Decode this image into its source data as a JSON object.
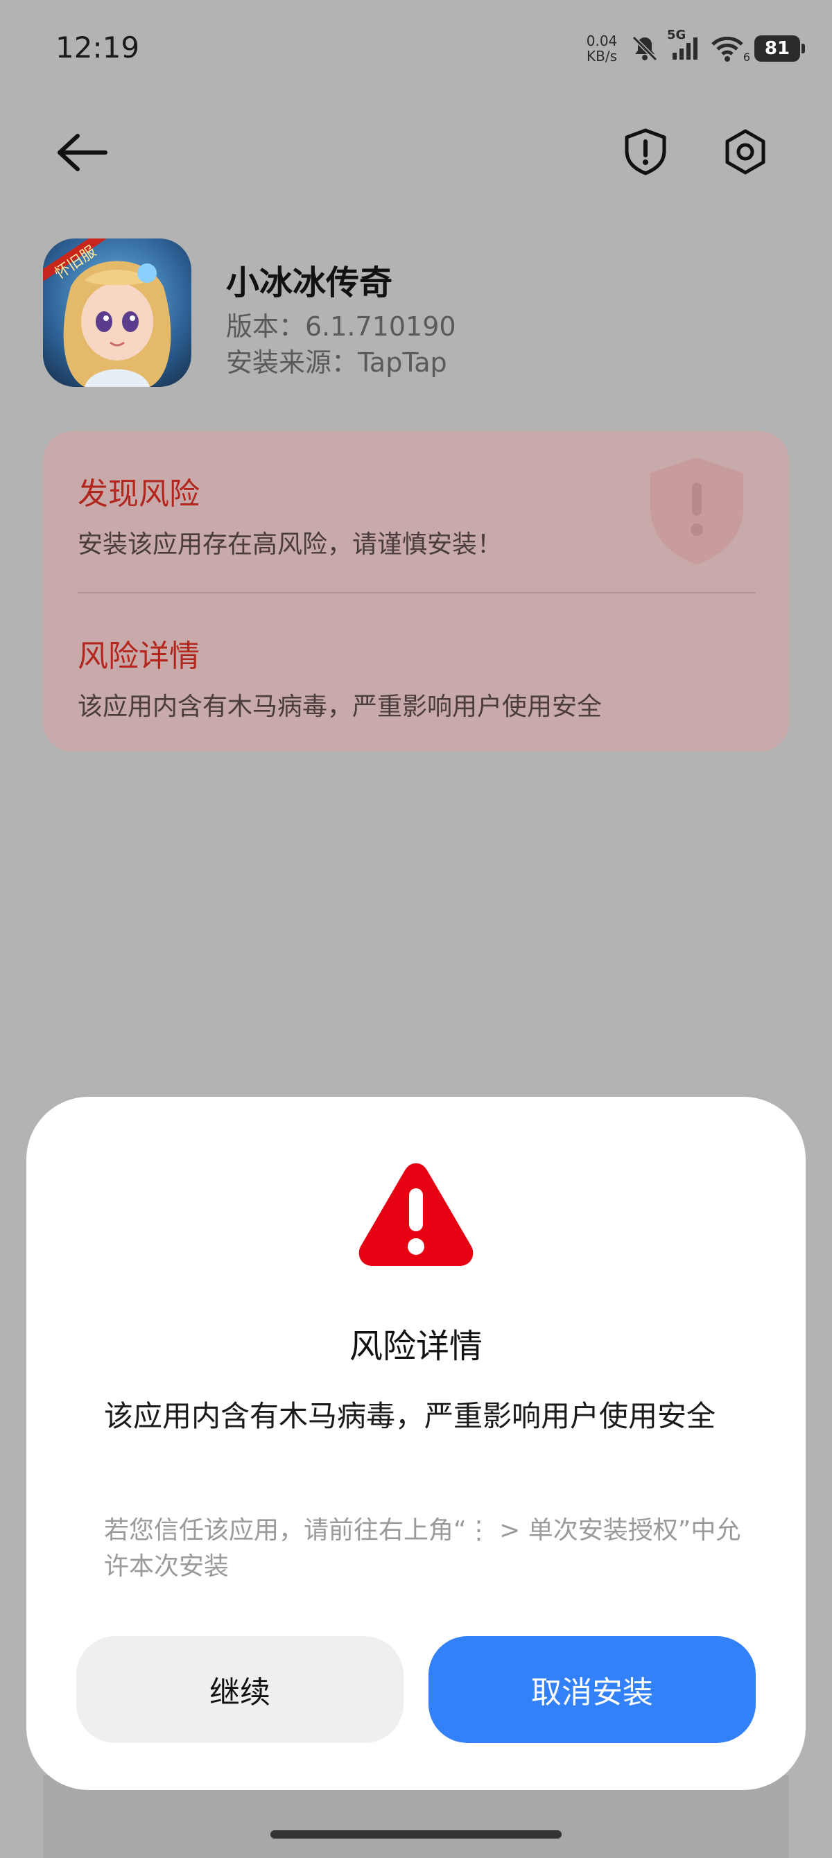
{
  "status_bar": {
    "time": "12:19",
    "net_speed_value": "0.04",
    "net_speed_unit": "KB/s",
    "network_type": "5G",
    "wifi_level": "6",
    "battery_level": "81",
    "icons": [
      "mute-bell-icon",
      "cellular-signal-icon",
      "wifi-icon",
      "battery-icon"
    ]
  },
  "nav": {
    "back_icon": "back-arrow-icon",
    "actions": [
      "shield-alert-icon",
      "settings-gear-icon"
    ]
  },
  "app": {
    "name": "小冰冰传奇",
    "version": "版本：6.1.710190",
    "source": "安装来源：TapTap",
    "icon_badge": "怀旧服"
  },
  "risk_card": {
    "found_title": "发现风险",
    "found_text": "安装该应用存在高风险，请谨慎安装！",
    "details_title": "风险详情",
    "details_text": "该应用内含有木马病毒，严重影响用户使用安全"
  },
  "dialog": {
    "title": "风险详情",
    "body": "该应用内含有木马病毒，严重影响用户使用安全",
    "hint": "若您信任该应用，请前往右上角“⋮ > 单次安装授权”中允许本次安装",
    "continue_label": "继续",
    "cancel_label": "取消安装"
  },
  "colors": {
    "accent": "#3381f8",
    "danger": "#e60012",
    "risk_text": "#b3261e",
    "scrim": "#b3b3b3"
  }
}
